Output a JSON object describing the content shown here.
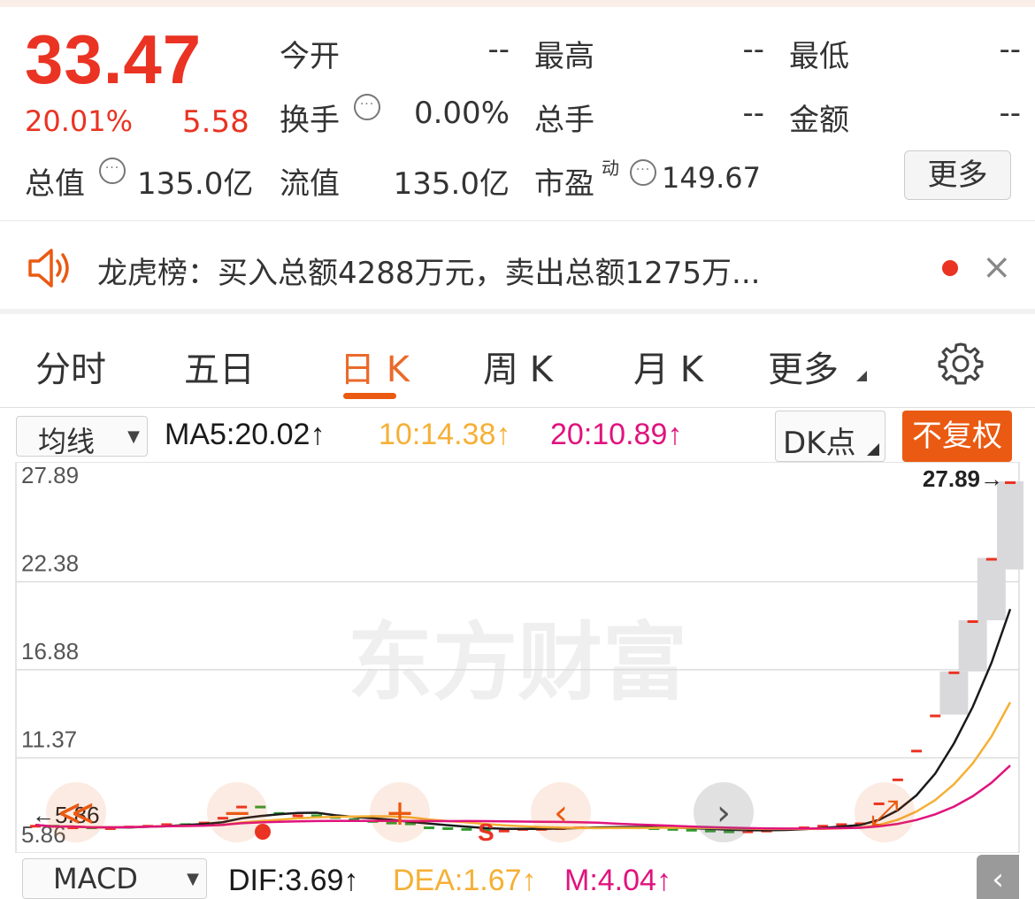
{
  "quote": {
    "price": "33.47",
    "change_pct": "20.01%",
    "change_amt": "5.58",
    "rows": [
      [
        {
          "label": "今开",
          "value": "--"
        },
        {
          "label": "最高",
          "value": "--"
        },
        {
          "label": "最低",
          "value": "--"
        }
      ],
      [
        {
          "label": "换手",
          "value": "0.00%"
        },
        {
          "label": "总手",
          "value": "--"
        },
        {
          "label": "金额",
          "value": "--"
        }
      ],
      [
        {
          "label": "总值",
          "value": "135.0亿"
        },
        {
          "label": "流值",
          "value": "135.0亿"
        },
        {
          "label": "市盈",
          "value": "149.67",
          "sup": "动"
        }
      ]
    ],
    "more_label": "更多",
    "info_icon_glyph": "···"
  },
  "news": {
    "text": "龙虎榜：买入总额4288万元，卖出总额1275万...",
    "has_unread": true
  },
  "tabs": {
    "items": [
      "分时",
      "五日",
      "日 K",
      "周 K",
      "月 K",
      "更多"
    ],
    "active_index": 2
  },
  "toolbar": {
    "indicator_select": "均线",
    "ma5": "MA5:20.02↑",
    "ma10": "10:14.38↑",
    "ma20": "20:10.89↑",
    "dk_label": "DK点",
    "adjust_label": "不复权"
  },
  "colors": {
    "up": "#ea3323",
    "down": "#2e9c2e",
    "accent": "#ea5a12",
    "ma5": "#1a1a1a",
    "ma10": "#f5b035",
    "ma20": "#e0137d"
  },
  "chart_data": {
    "type": "candlestick",
    "y_ticks": [
      "27.89",
      "22.38",
      "16.88",
      "11.37",
      "5.86"
    ],
    "ylim": [
      5.86,
      27.89
    ],
    "max_label": "27.89",
    "min_label": "5.86",
    "closes": [
      6.4,
      6.2,
      6.3,
      6.1,
      6.25,
      6.35,
      6.4,
      6.5,
      6.45,
      6.6,
      6.9,
      7.6,
      7.2,
      7.0,
      7.05,
      6.95,
      6.8,
      6.7,
      6.6,
      6.55,
      6.3,
      6.25,
      6.2,
      6.15,
      6.1,
      6.1,
      6.2,
      6.2,
      6.25,
      6.3,
      6.25,
      6.3,
      6.25,
      6.2,
      6.15,
      6.1,
      6.05,
      6.0,
      6.05,
      6.1,
      6.2,
      6.3,
      6.4,
      6.5,
      6.55,
      7.8,
      9.3,
      11.1,
      13.3,
      16.0,
      19.2,
      23.1,
      27.89
    ],
    "ma_values": {
      "MA5": 20.02,
      "MA10": 14.38,
      "MA20": 10.89
    },
    "signal_labels": [
      "S"
    ]
  },
  "macd": {
    "select": "MACD",
    "dif": "DIF:3.69↑",
    "dea": "DEA:1.67↑",
    "m": "M:4.04↑"
  },
  "watermark": "东方财富",
  "back_glyph": "‹"
}
